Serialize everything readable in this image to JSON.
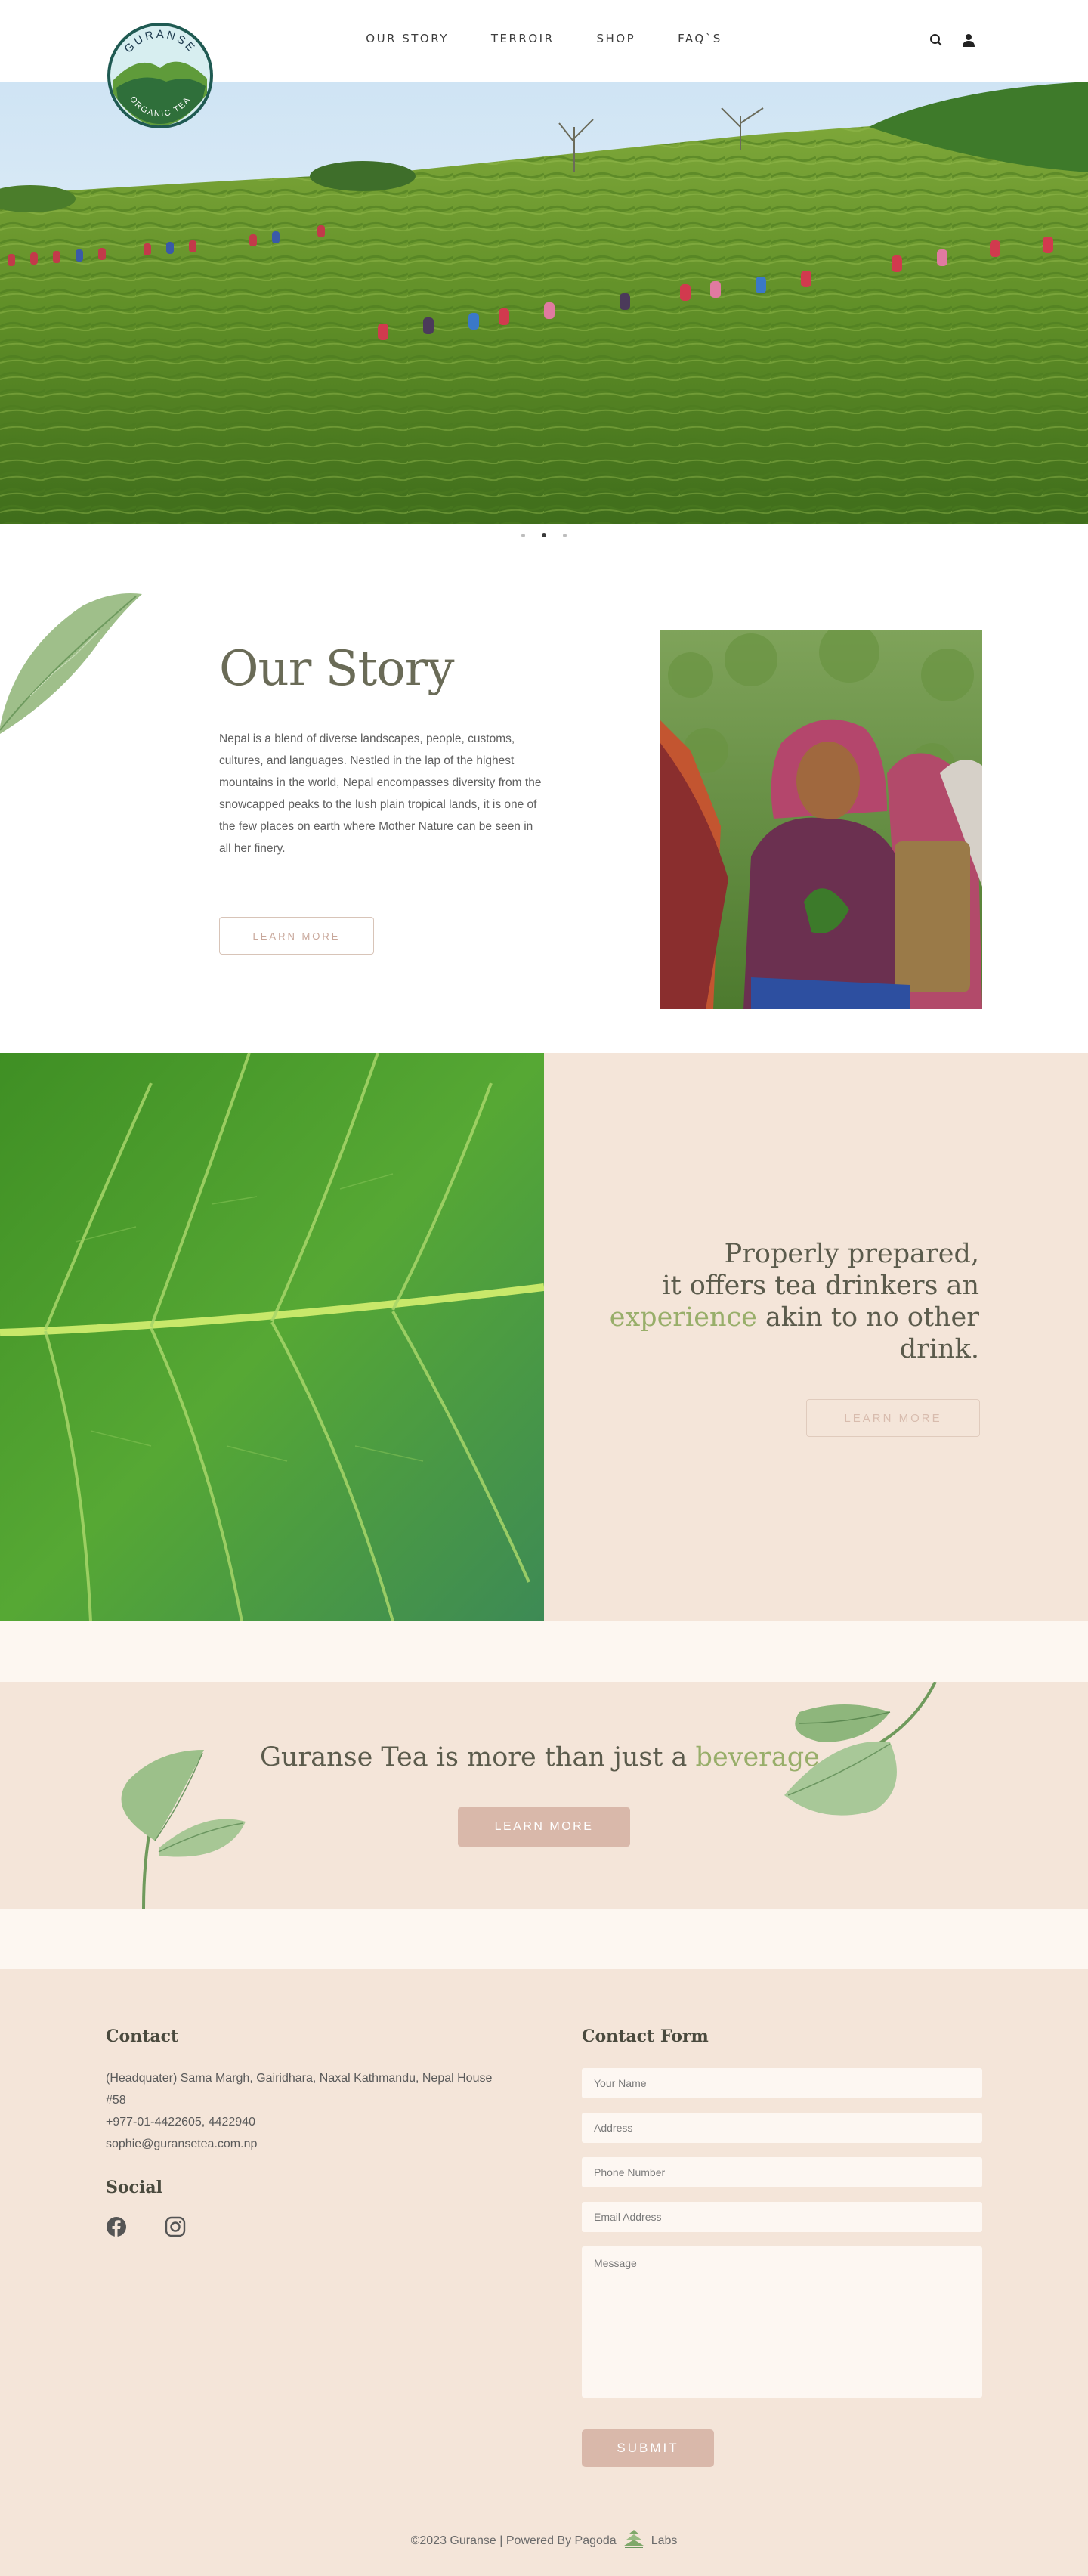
{
  "brand": {
    "logo_text_top": "GURANSE",
    "logo_text_bottom": "ORGANIC TEA"
  },
  "nav": {
    "items": [
      "OUR STORY",
      "TERROIR",
      "SHOP",
      "FAQ`S"
    ]
  },
  "hero": {
    "slide_count": 3,
    "active_slide": 2
  },
  "story": {
    "title": "Our Story",
    "text": "Nepal is a blend of diverse landscapes, people, customs, cultures, and languages. Nestled in the lap of the highest mountains in the world, Nepal encompasses diversity from the snowcapped peaks to the lush plain tropical lands, it is one of the few places on earth where Mother Nature can be seen in all her finery.",
    "button": "LEARN MORE"
  },
  "experience": {
    "line1": "Properly prepared,",
    "line2": "it offers tea drinkers an",
    "highlight": "experience",
    "line3_rest": " akin to no other drink.",
    "button": "LEARN MORE"
  },
  "beverage": {
    "text": "Guranse Tea is more than just a ",
    "highlight": "beverage.",
    "button": "LEARN MORE"
  },
  "footer": {
    "contact_heading": "Contact",
    "address_line1": "(Headquater) Sama Margh, Gairidhara, Naxal Kathmandu, Nepal House",
    "address_line2": "#58",
    "phone": "+977-01-4422605, 4422940",
    "email": "sophie@guransetea.com.np",
    "social_heading": "Social",
    "form_heading": "Contact Form",
    "placeholders": {
      "name": "Your Name",
      "address": "Address",
      "phone": "Phone Number",
      "email": "Email Address",
      "message": "Message"
    },
    "submit": "SUBMIT",
    "copyright": "©2023 Guranse | Powered By Pagoda",
    "labs": "Labs"
  },
  "colors": {
    "accent_green": "#98ae6a",
    "panel_beige": "#f4e5d9",
    "button_rose": "#d9b8aa",
    "cream": "#fdf7f1"
  }
}
